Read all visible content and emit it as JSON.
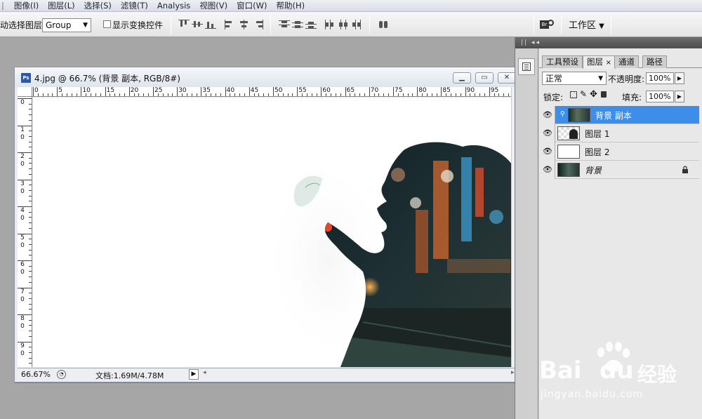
{
  "menu": [
    "图像(I)",
    "图层(L)",
    "选择(S)",
    "滤镜(T)",
    "Analysis",
    "视图(V)",
    "窗口(W)",
    "帮助(H)"
  ],
  "options": {
    "auto_select_label": "动选择图层",
    "auto_select_value": "Group",
    "show_transform_label": "显示变换控件",
    "workspace_label": "工作区"
  },
  "document": {
    "title": "4.jpg @ 66.7% (背景 副本, RGB/8#)",
    "ps_icon": "Ps",
    "ruler_top": [
      "0",
      "5",
      "10",
      "15",
      "20",
      "25",
      "30",
      "35",
      "40",
      "45",
      "50",
      "55",
      "60",
      "65",
      "70",
      "75",
      "80",
      "85",
      "90",
      "95"
    ],
    "ruler_left": [
      "0",
      "1\n0",
      "2\n0",
      "3\n0",
      "4\n0",
      "5\n0",
      "6\n0",
      "7\n0",
      "8\n0",
      "9\n0"
    ],
    "zoom": "66.67%",
    "doc_size": "文档:1.69M/4.78M"
  },
  "layers_panel": {
    "tabs": [
      "工具预设",
      "图层",
      "通道",
      "路径"
    ],
    "tab_close": "×",
    "blend_mode": "正常",
    "opacity_label": "不透明度:",
    "opacity_value": "100%",
    "lock_label": "锁定:",
    "fill_label": "填充:",
    "fill_value": "100%",
    "layers": [
      {
        "name": "背景 副本",
        "selected": true
      },
      {
        "name": "图层 1",
        "selected": false
      },
      {
        "name": "图层 2",
        "selected": false
      },
      {
        "name": "背景",
        "selected": false,
        "locked": true
      }
    ]
  },
  "watermark": {
    "brand": "Bai",
    "brand2": "du",
    "cn": "经验",
    "url": "jingyan.baidu.com"
  },
  "colors": {
    "selected_layer": "#3c8ee8",
    "accent_red": "#e8452a"
  }
}
